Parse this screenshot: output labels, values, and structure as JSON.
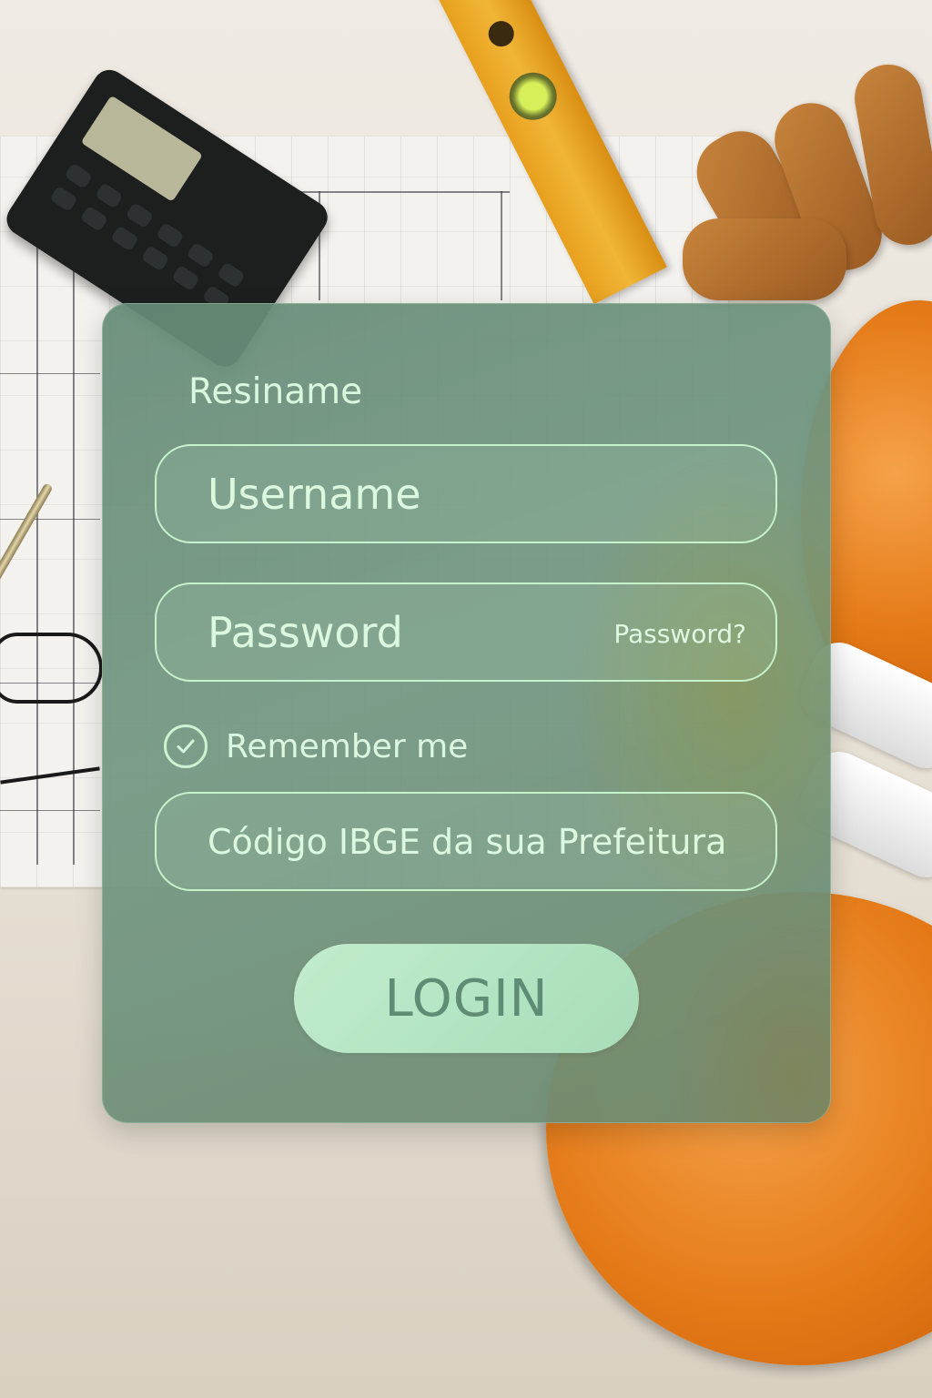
{
  "form": {
    "title": "Resiname",
    "username": {
      "placeholder": "Username"
    },
    "password": {
      "placeholder": "Password",
      "forgot_label": "Password?"
    },
    "remember": {
      "label": "Remember me",
      "checked": true
    },
    "ibge": {
      "placeholder": "Código IBGE da sua Prefeitura"
    },
    "login_label": "LOGIN"
  },
  "colors": {
    "card_tint": "#6f9680",
    "field_border": "#c6f3cc",
    "text": "#d9f8dd",
    "button_bg": "#b8e7c6",
    "button_text": "#5f8c74"
  },
  "icons": {
    "remember_check": "check-circle-icon"
  }
}
